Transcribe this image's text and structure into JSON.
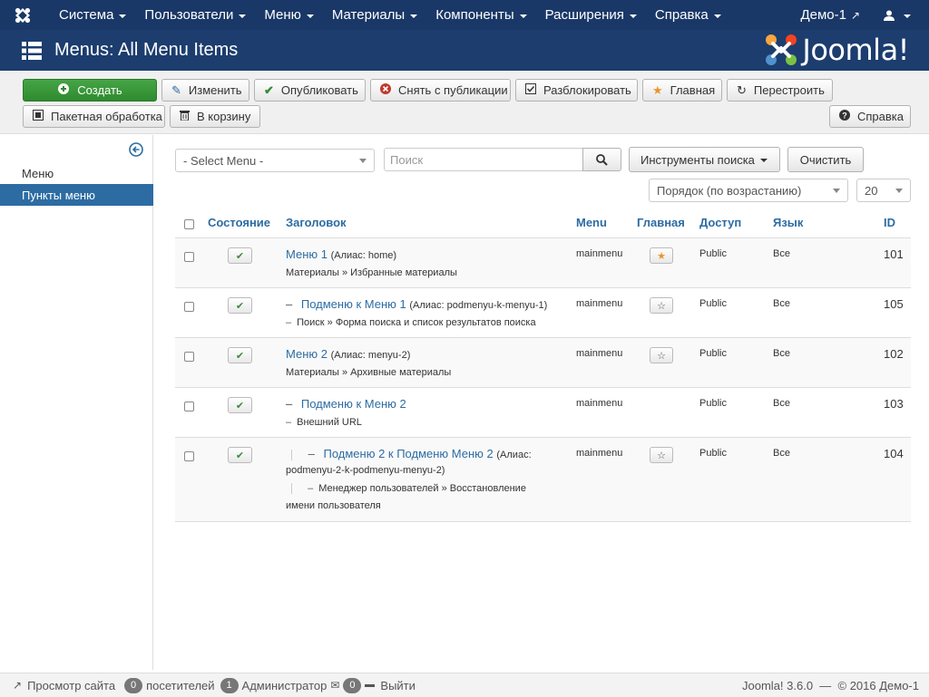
{
  "navbar": {
    "logo_icon": "joomla-icon",
    "menus": [
      "Система",
      "Пользователи",
      "Меню",
      "Материалы",
      "Компоненты",
      "Расширения",
      "Справка"
    ],
    "site_link": "Демо-1",
    "user_icon": "user-icon"
  },
  "header": {
    "page_title": "Menus: All Menu Items",
    "brand": "Joomla!"
  },
  "toolbar": {
    "new": "Создать",
    "edit": "Изменить",
    "publish": "Опубликовать",
    "unpublish": "Снять с публикации",
    "checkin": "Разблокировать",
    "home": "Главная",
    "rebuild": "Перестроить",
    "batch": "Пакетная обработка",
    "trash": "В корзину",
    "help": "Справка"
  },
  "sidebar": {
    "items": [
      {
        "label": "Меню",
        "active": false
      },
      {
        "label": "Пункты меню",
        "active": true
      }
    ]
  },
  "filters": {
    "select_menu": "- Select Menu -",
    "search_placeholder": "Поиск",
    "search_tools": "Инструменты поиска",
    "clear": "Очистить",
    "ordering": "Порядок (по возрастанию)",
    "limit": "20"
  },
  "table": {
    "headers": {
      "status": "Состояние",
      "title": "Заголовок",
      "menu": "Menu",
      "home": "Главная",
      "access": "Доступ",
      "language": "Язык",
      "id": "ID"
    },
    "rows": [
      {
        "title": "Меню 1",
        "alias": "(Алиас: home)",
        "type": "Материалы » Избранные материалы",
        "menu": "mainmenu",
        "home": "default",
        "access": "Public",
        "language": "Все",
        "id": "101"
      },
      {
        "title": "Подменю к Меню 1",
        "alias": "(Алиас: podmenyu-k-menyu-1)",
        "type": "Поиск » Форма поиска и список результатов поиска",
        "menu": "mainmenu",
        "home": "not-default",
        "access": "Public",
        "language": "Все",
        "id": "105"
      },
      {
        "title": "Меню 2",
        "alias": "(Алиас: menyu-2)",
        "type": "Материалы » Архивные материалы",
        "menu": "mainmenu",
        "home": "not-default",
        "access": "Public",
        "language": "Все",
        "id": "102"
      },
      {
        "title": "Подменю к Меню 2",
        "alias": "",
        "type": "Внешний URL",
        "menu": "mainmenu",
        "home": "none",
        "access": "Public",
        "language": "Все",
        "id": "103"
      },
      {
        "title": "Подменю 2 к Подменю Меню 2",
        "alias": "(Алиас:",
        "alias2": "podmenyu-2-k-podmenyu-menyu-2)",
        "type": "Менеджер пользователей » Восстановление",
        "type2": "имени пользователя",
        "menu": "mainmenu",
        "home": "not-default",
        "access": "Public",
        "language": "Все",
        "id": "104"
      }
    ]
  },
  "statusbar": {
    "view_site": "Просмотр сайта",
    "visitors_count": "0",
    "visitors": "посетителей",
    "admins_count": "1",
    "admins": "Администратор",
    "messages_count": "0",
    "logout": "Выйти",
    "version": "Joomla! 3.6.0  —  © 2016 Демо-1"
  },
  "colors": {
    "navbar": "#1a3867",
    "header": "#1c3d6e",
    "accent": "#2d6ca2",
    "success": "#46a546"
  }
}
